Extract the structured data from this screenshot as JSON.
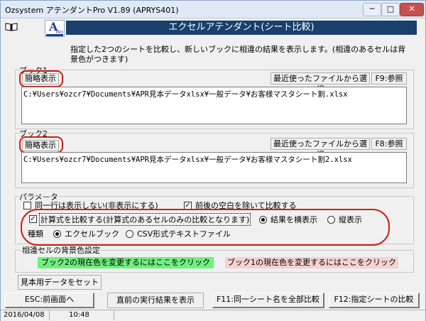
{
  "window": {
    "title": "Ozsystem アテンダントPro V1.89 (APRYS401)",
    "minimize": "─",
    "maximize": "□",
    "close": "✕"
  },
  "header": {
    "logo_letter": "A",
    "logo_sub": "PRO",
    "banner": "エクセルアテンダント(シート比較)"
  },
  "description": "指定した2つのシートを比較し、新しいブックに相違の結果を表示します。(相違のあるセルは背景色がつきます)",
  "book1": {
    "label": "ブック1",
    "simple_button": "簡略表示",
    "recent_button": "最近使ったファイルから選択",
    "browse_button": "F9:参照",
    "path": "C:¥Users¥ozcr7¥Documents¥APR見本データxlsx¥一般データ¥お客様マスタシート割.xlsx"
  },
  "book2": {
    "label": "ブック2",
    "simple_button": "簡略表示",
    "recent_button": "最近使ったファイルから選択",
    "browse_button": "F8:参照",
    "path": "C:¥Users¥ozcr7¥Documents¥APR見本データxlsx¥一般データ¥お客様マスタシート割2.xlsx"
  },
  "params": {
    "label": "パラメータ",
    "opt_same_row_hidden": "同一行は表示しない(非表示にする)",
    "opt_trim_spaces": "前後の空白を除いて比較する",
    "opt_compare_formula": "計算式を比較する(計算式のあるセルのみの比較となります)",
    "layout_horizontal": "結果を横表示",
    "layout_vertical": "縦表示",
    "type_label": "種類",
    "type_excel": "エクセルブック",
    "type_csv": "CSV形式テキストファイル"
  },
  "colors": {
    "label": "相違セルの背景色設定",
    "book2_color_text": "ブック2の現在色を変更するにはここをクリック",
    "book1_color_text": "ブック1の現在色を変更するにはここをクリック",
    "book2_color": "#6ff07e",
    "book1_color": "#f6d1d1"
  },
  "buttons": {
    "sample": "見本用データをセット",
    "esc": "ESC:前画面へ",
    "prev_result": "直前の実行結果を表示",
    "f11": "F11:同一シート名を全部比較",
    "f12": "F12:指定シートの比較"
  },
  "status": {
    "date": "2016/04/08",
    "time": "10:48"
  },
  "accent": "#d01f17"
}
